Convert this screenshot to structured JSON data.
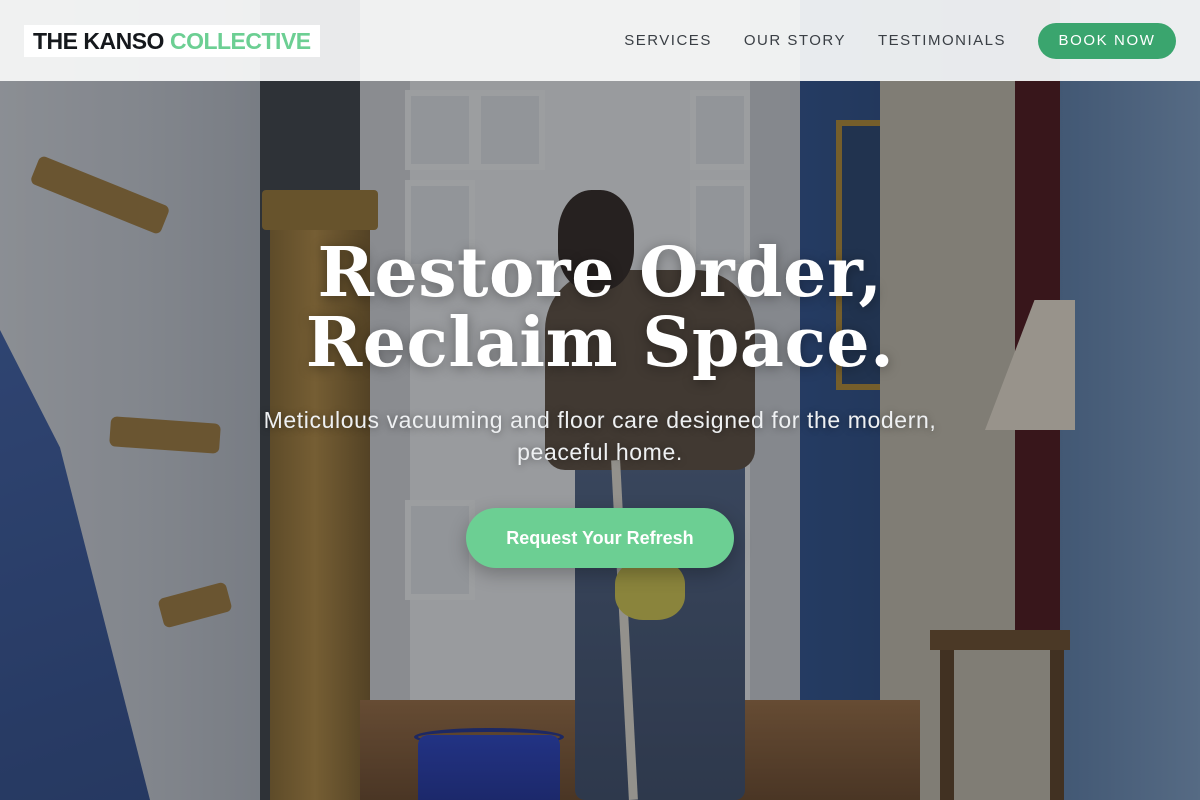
{
  "header": {
    "logo_primary": "THE KANSO",
    "logo_accent": "COLLECTIVE",
    "nav": [
      {
        "label": "SERVICES"
      },
      {
        "label": "OUR STORY"
      },
      {
        "label": "TESTIMONIALS"
      }
    ],
    "book_label": "BOOK NOW"
  },
  "hero": {
    "headline_line1": "Restore Order,",
    "headline_line2": "Reclaim Space.",
    "subheadline": "Meticulous vacuuming and floor care designed for the modern, peaceful home.",
    "cta_label": "Request Your Refresh"
  },
  "colors": {
    "brand_green": "#3aa56e",
    "accent_green": "#6ccf93",
    "header_bg": "#f8f9f9",
    "text_dark": "#15181c"
  }
}
